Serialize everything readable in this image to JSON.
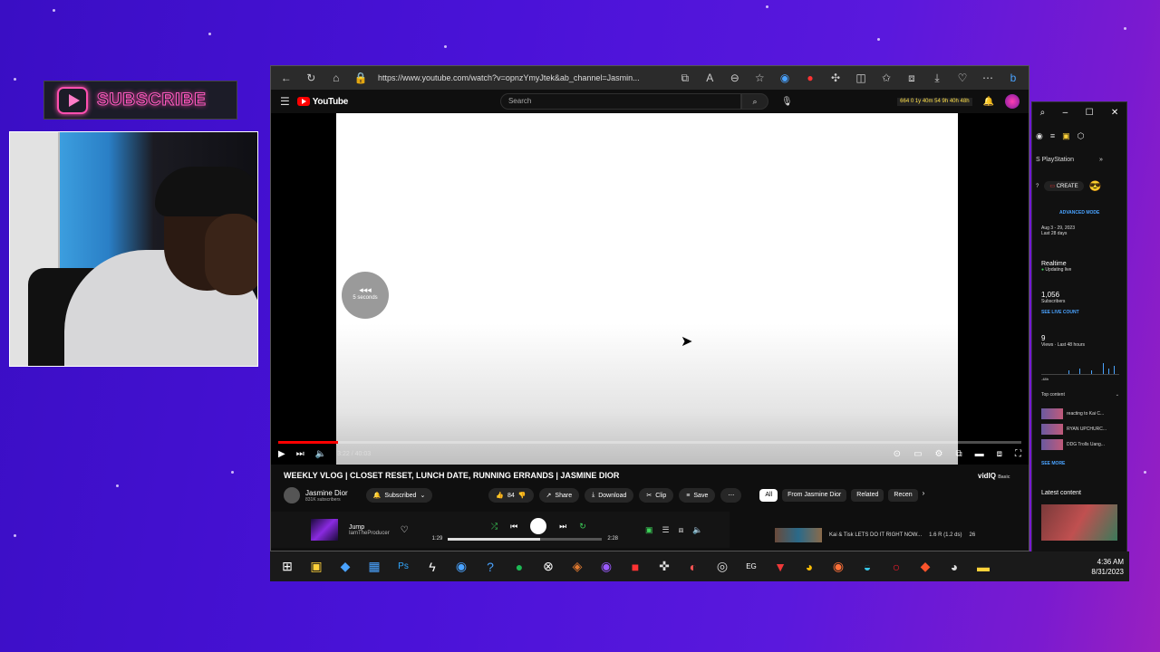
{
  "overlay": {
    "subscribe_label": "SUBSCRIBE"
  },
  "browser": {
    "url": "https://www.youtube.com/watch?v=opnzYmyJtek&ab_channel=Jasmin..."
  },
  "youtube": {
    "logo_text": "YouTube",
    "search_placeholder": "Search",
    "header_stats": "664 0 1y 40m 54 9h 40h 48h",
    "player": {
      "seek_label": "5 seconds",
      "time": "3:22 / 40:03",
      "progress_fraction": 0.08
    },
    "video": {
      "title": "WEEKLY VLOG | CLOSET RESET, LUNCH DATE, RUNNING ERRANDS | JASMINE DIOR",
      "channel": "Jasmine Dior",
      "subscribers": "831K subscribers",
      "subscribed_label": "Subscribed",
      "like_count": "84",
      "share_label": "Share",
      "download_label": "Download",
      "clip_label": "Clip",
      "save_label": "Save",
      "vidiq_label": "vidIQ",
      "vidiq_sub": "Basic"
    },
    "chips": [
      "All",
      "From Jasmine Dior",
      "Related",
      "Recen"
    ],
    "related": {
      "title": "Kai & Tisk LETS DO IT RIGHT NOW...",
      "meta": "1.6 R  (1.2 ds)",
      "count": "26"
    }
  },
  "music": {
    "song": "Jump",
    "artist": "IamTheProducer",
    "elapsed": "1:29",
    "duration": "2:28",
    "progress_fraction": 0.6
  },
  "panel": {
    "channel": "PlayStation",
    "create_label": "CREATE",
    "advanced_mode": "ADVANCED MODE",
    "date_range": "Aug 3 - 29, 2023",
    "date_sub": "Last 28 days",
    "realtime": "Realtime",
    "realtime_sub": "Updating live",
    "subs_count": "1,056",
    "subs_label": "Subscribers",
    "see_live_count": "SEE LIVE COUNT",
    "views_count": "9",
    "views_label": "Views · Last 48 hours",
    "chart_left": "-48h",
    "top_content": "Top content",
    "top_items": [
      "reacting to Kai C...",
      "RYAN UPCHURC...",
      "DDG Trolls Uang..."
    ],
    "see_more": "SEE MORE",
    "latest_content": "Latest content"
  },
  "taskbar": {
    "time": "4:36 AM",
    "date": "8/31/2023"
  }
}
